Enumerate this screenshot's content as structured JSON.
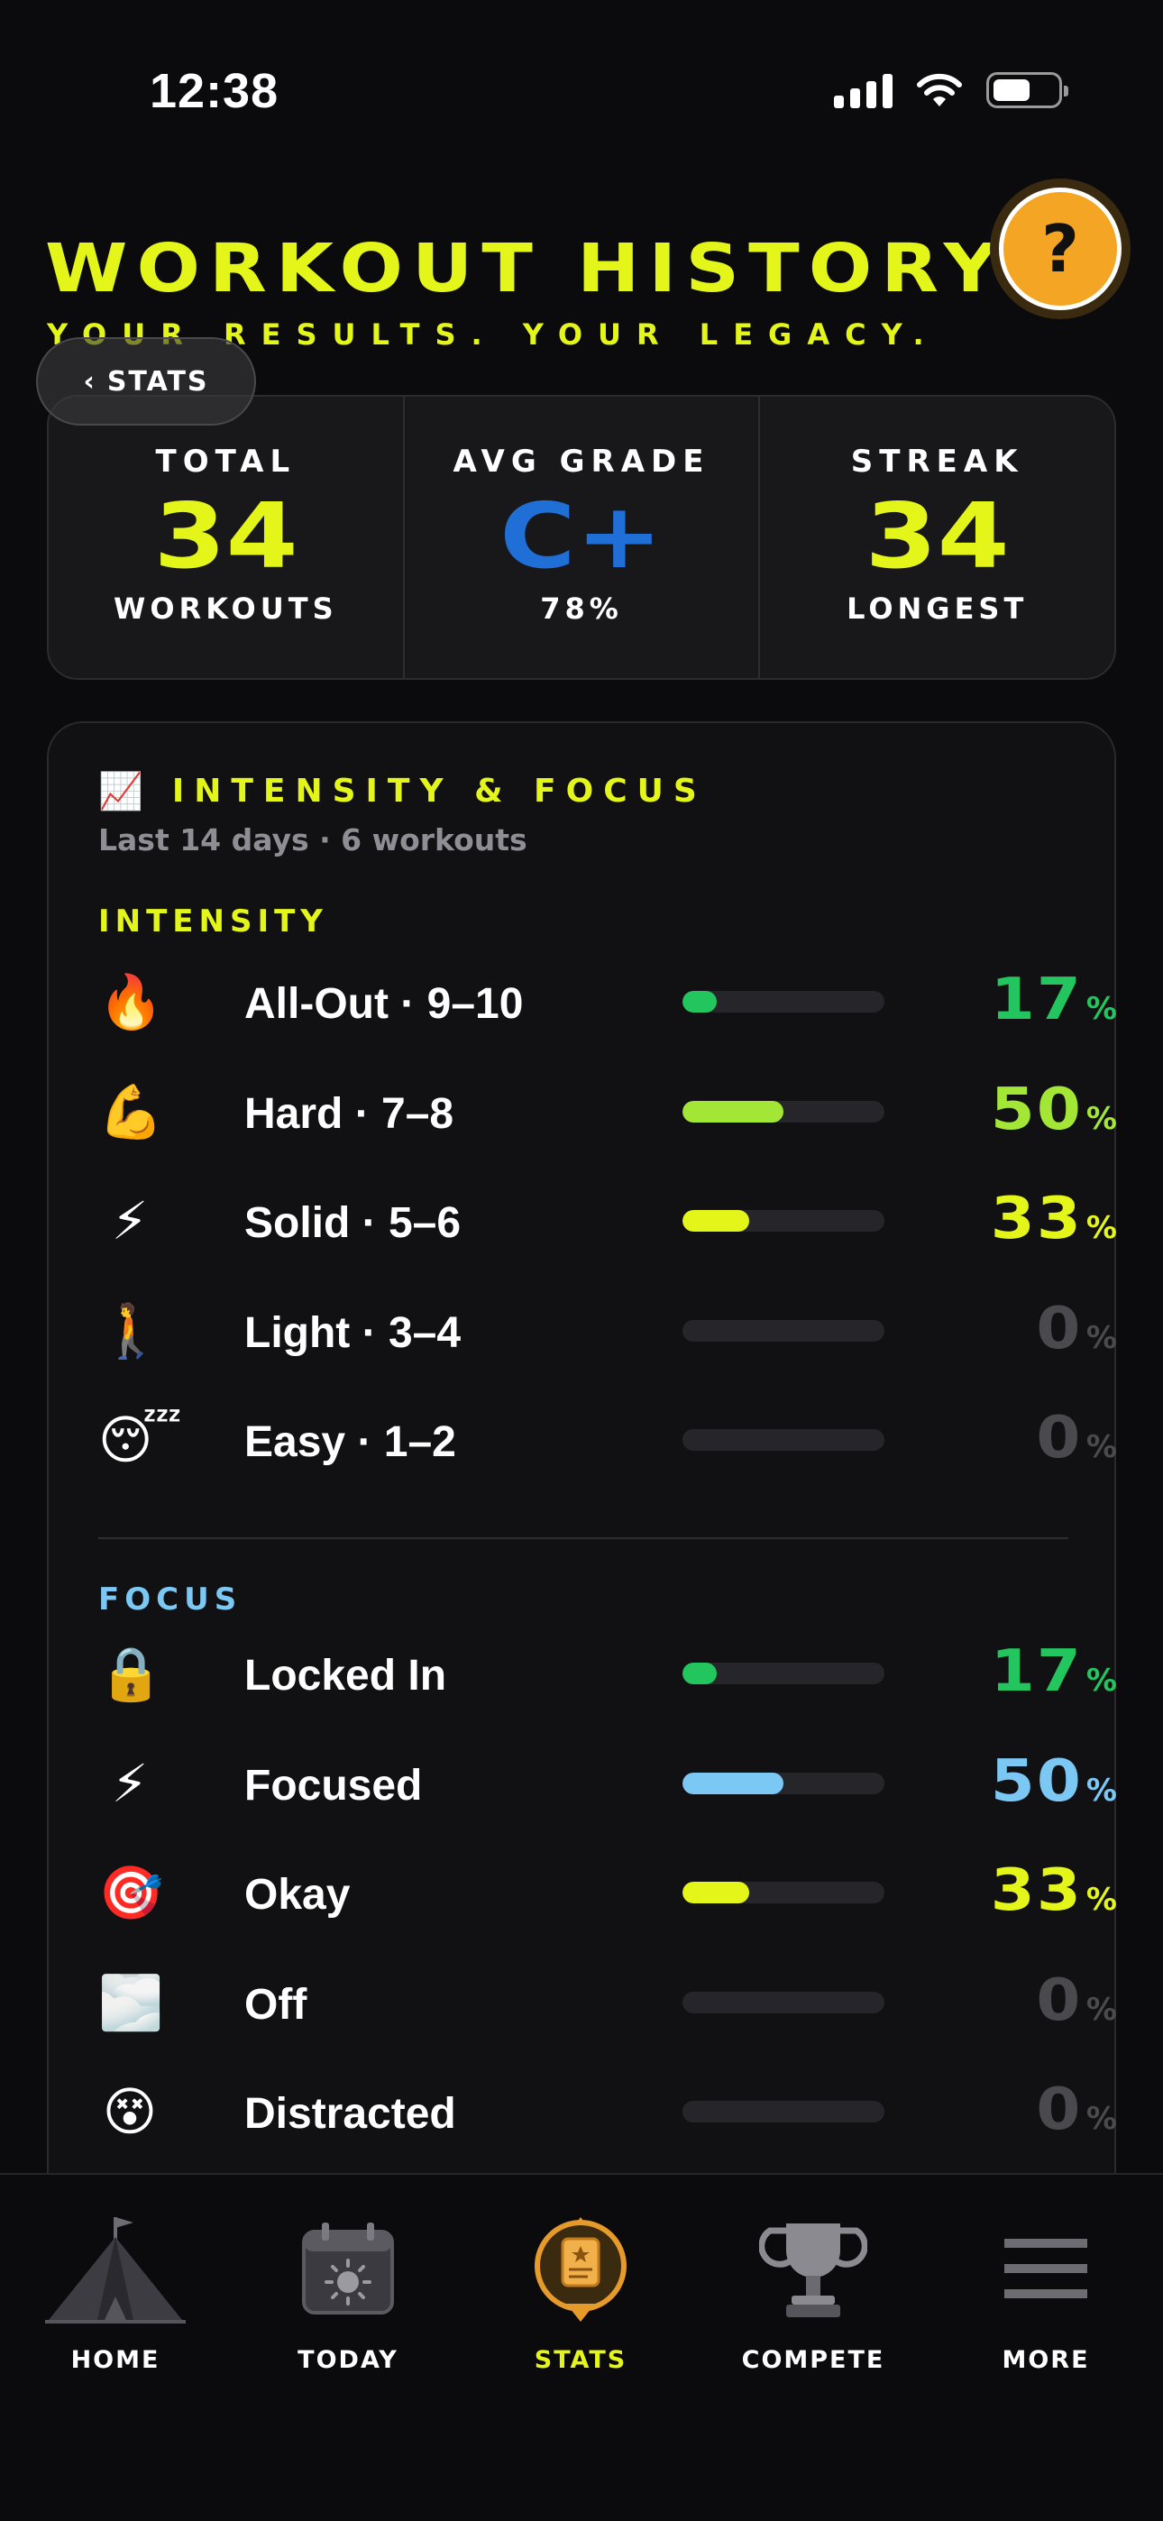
{
  "status_bar": {
    "time": "12:38"
  },
  "header": {
    "title": "WORKOUT HISTORY",
    "subtitle": "YOUR RESULTS. YOUR LEGACY.",
    "back_label": "STATS",
    "help_label": "?"
  },
  "stats": {
    "total": {
      "label": "TOTAL",
      "value": "34",
      "caption": "WORKOUTS",
      "color": "#e4f51a"
    },
    "avg_grade": {
      "label": "AVG GRADE",
      "value": "C+",
      "caption": "78%",
      "color": "#1f6fd6"
    },
    "streak": {
      "label": "STREAK",
      "value": "34",
      "caption": "LONGEST",
      "color": "#e4f51a"
    }
  },
  "intensity_focus": {
    "icon": "chart-increasing-icon",
    "title": "INTENSITY & FOCUS",
    "subtitle": "Last 14 days · 6 workouts",
    "intensity": {
      "label": "INTENSITY",
      "color": "#e4f51a",
      "rows": [
        {
          "emoji": "🔥",
          "label": "All-Out · 9–10",
          "percent": 17,
          "value": "17",
          "unit": "%",
          "color": "#22c55e"
        },
        {
          "emoji": "💪",
          "label": "Hard · 7–8",
          "percent": 50,
          "value": "50",
          "unit": "%",
          "color": "#a3e635"
        },
        {
          "emoji": "⚡",
          "label": "Solid · 5–6",
          "percent": 33,
          "value": "33",
          "unit": "%",
          "color": "#e4f51a"
        },
        {
          "emoji": "🚶",
          "label": "Light · 3–4",
          "percent": 0,
          "value": "0",
          "unit": "%",
          "color": "#4a4a4e"
        },
        {
          "emoji": "😴",
          "label": "Easy · 1–2",
          "percent": 0,
          "value": "0",
          "unit": "%",
          "color": "#4a4a4e"
        }
      ]
    },
    "focus": {
      "label": "FOCUS",
      "color": "#7cc8f5",
      "rows": [
        {
          "emoji": "🔒",
          "label": "Locked In",
          "percent": 17,
          "value": "17",
          "unit": "%",
          "color": "#22c55e"
        },
        {
          "emoji": "⚡",
          "label": "Focused",
          "percent": 50,
          "value": "50",
          "unit": "%",
          "color": "#7cc8f5"
        },
        {
          "emoji": "🎯",
          "label": "Okay",
          "percent": 33,
          "value": "33",
          "unit": "%",
          "color": "#e4f51a"
        },
        {
          "emoji": "🌫️",
          "label": "Off",
          "percent": 0,
          "value": "0",
          "unit": "%",
          "color": "#4a4a4e"
        },
        {
          "emoji": "😵",
          "label": "Distracted",
          "percent": 0,
          "value": "0",
          "unit": "%",
          "color": "#4a4a4e"
        }
      ]
    }
  },
  "nav": {
    "items": [
      {
        "label": "HOME",
        "icon": "tent-icon",
        "active": false
      },
      {
        "label": "TODAY",
        "icon": "calendar-sun-icon",
        "active": false
      },
      {
        "label": "STATS",
        "icon": "scroll-badge-icon",
        "active": true
      },
      {
        "label": "COMPETE",
        "icon": "trophy-icon",
        "active": false
      },
      {
        "label": "MORE",
        "icon": "hamburger-menu-icon",
        "active": false
      }
    ],
    "active_color": "#e4f51a"
  }
}
